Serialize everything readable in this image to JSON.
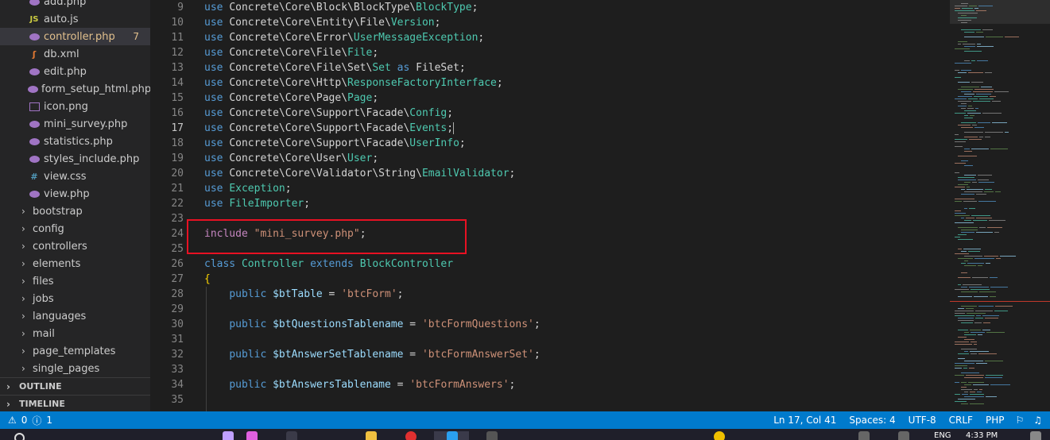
{
  "explorer": {
    "files": [
      {
        "name": "add.php",
        "icon": "php-file-icon"
      },
      {
        "name": "auto.js",
        "icon": "js-file-icon",
        "glyph": "JS"
      },
      {
        "name": "controller.php",
        "icon": "php-file-icon",
        "badge": "7",
        "active": true
      },
      {
        "name": "db.xml",
        "icon": "rss-file-icon",
        "glyph": "ʃ"
      },
      {
        "name": "edit.php",
        "icon": "php-file-icon"
      },
      {
        "name": "form_setup_html.php",
        "icon": "php-file-icon"
      },
      {
        "name": "icon.png",
        "icon": "image-file-icon"
      },
      {
        "name": "mini_survey.php",
        "icon": "php-file-icon"
      },
      {
        "name": "statistics.php",
        "icon": "php-file-icon"
      },
      {
        "name": "styles_include.php",
        "icon": "php-file-icon"
      },
      {
        "name": "view.css",
        "icon": "css-file-icon",
        "glyph": "#"
      },
      {
        "name": "view.php",
        "icon": "php-file-icon"
      }
    ],
    "folders": [
      "bootstrap",
      "config",
      "controllers",
      "elements",
      "files",
      "jobs",
      "languages",
      "mail",
      "page_templates",
      "single_pages"
    ],
    "outline_label": "OUTLINE",
    "timeline_label": "TIMELINE"
  },
  "editor": {
    "current_line": 17,
    "lines": [
      {
        "n": "9",
        "t": [
          [
            "kw",
            "use "
          ],
          [
            "",
            "Concrete\\Core\\Block\\BlockType\\"
          ],
          [
            "ty",
            "BlockType"
          ],
          [
            "",
            ";"
          ]
        ]
      },
      {
        "n": "10",
        "t": [
          [
            "kw",
            "use "
          ],
          [
            "",
            "Concrete\\Core\\Entity\\File\\"
          ],
          [
            "ty",
            "Version"
          ],
          [
            "",
            ";"
          ]
        ]
      },
      {
        "n": "11",
        "t": [
          [
            "kw",
            "use "
          ],
          [
            "",
            "Concrete\\Core\\Error\\"
          ],
          [
            "ty",
            "UserMessageException"
          ],
          [
            "",
            ";"
          ]
        ]
      },
      {
        "n": "12",
        "t": [
          [
            "kw",
            "use "
          ],
          [
            "",
            "Concrete\\Core\\File\\"
          ],
          [
            "ty",
            "File"
          ],
          [
            "",
            ";"
          ]
        ]
      },
      {
        "n": "13",
        "t": [
          [
            "kw",
            "use "
          ],
          [
            "",
            "Concrete\\Core\\File\\Set\\"
          ],
          [
            "ty",
            "Set"
          ],
          [
            "kw",
            " as "
          ],
          [
            "",
            "FileSet;"
          ]
        ]
      },
      {
        "n": "14",
        "t": [
          [
            "kw",
            "use "
          ],
          [
            "",
            "Concrete\\Core\\Http\\"
          ],
          [
            "ty",
            "ResponseFactoryInterface"
          ],
          [
            "",
            ";"
          ]
        ]
      },
      {
        "n": "15",
        "t": [
          [
            "kw",
            "use "
          ],
          [
            "",
            "Concrete\\Core\\Page\\"
          ],
          [
            "ty",
            "Page"
          ],
          [
            "",
            ";"
          ]
        ]
      },
      {
        "n": "16",
        "t": [
          [
            "kw",
            "use "
          ],
          [
            "",
            "Concrete\\Core\\Support\\Facade\\"
          ],
          [
            "ty",
            "Config"
          ],
          [
            "",
            ";"
          ]
        ]
      },
      {
        "n": "17",
        "t": [
          [
            "kw",
            "use "
          ],
          [
            "",
            "Concrete\\Core\\Support\\Facade\\"
          ],
          [
            "ty",
            "Events"
          ],
          [
            "",
            ";"
          ]
        ],
        "cursor": true
      },
      {
        "n": "18",
        "t": [
          [
            "kw",
            "use "
          ],
          [
            "",
            "Concrete\\Core\\Support\\Facade\\"
          ],
          [
            "ty",
            "UserInfo"
          ],
          [
            "",
            ";"
          ]
        ]
      },
      {
        "n": "19",
        "t": [
          [
            "kw",
            "use "
          ],
          [
            "",
            "Concrete\\Core\\User\\"
          ],
          [
            "ty",
            "User"
          ],
          [
            "",
            ";"
          ]
        ]
      },
      {
        "n": "20",
        "t": [
          [
            "kw",
            "use "
          ],
          [
            "",
            "Concrete\\Core\\Validator\\String\\"
          ],
          [
            "ty",
            "EmailValidator"
          ],
          [
            "",
            ";"
          ]
        ]
      },
      {
        "n": "21",
        "t": [
          [
            "kw",
            "use "
          ],
          [
            "ty",
            "Exception"
          ],
          [
            "",
            ";"
          ]
        ]
      },
      {
        "n": "22",
        "t": [
          [
            "kw",
            "use "
          ],
          [
            "ty",
            "FileImporter"
          ],
          [
            "",
            ";"
          ]
        ]
      },
      {
        "n": "23",
        "t": []
      },
      {
        "n": "24",
        "t": [
          [
            "inc",
            "include "
          ],
          [
            "st",
            "\"mini_survey.php\""
          ],
          [
            "",
            ";"
          ]
        ]
      },
      {
        "n": "25",
        "t": []
      },
      {
        "n": "26",
        "t": [
          [
            "kw",
            "class "
          ],
          [
            "ty",
            "Controller "
          ],
          [
            "kw",
            "extends "
          ],
          [
            "ty",
            "BlockController"
          ]
        ]
      },
      {
        "n": "27",
        "t": [
          [
            "br",
            "{"
          ]
        ]
      },
      {
        "n": "28",
        "t": [
          [
            "",
            "    "
          ],
          [
            "kw",
            "public "
          ],
          [
            "va",
            "$btTable"
          ],
          [
            "",
            " = "
          ],
          [
            "st",
            "'btcForm'"
          ],
          [
            "",
            ";"
          ]
        ]
      },
      {
        "n": "29",
        "t": []
      },
      {
        "n": "30",
        "t": [
          [
            "",
            "    "
          ],
          [
            "kw",
            "public "
          ],
          [
            "va",
            "$btQuestionsTablename"
          ],
          [
            "",
            " = "
          ],
          [
            "st",
            "'btcFormQuestions'"
          ],
          [
            "",
            ";"
          ]
        ]
      },
      {
        "n": "31",
        "t": []
      },
      {
        "n": "32",
        "t": [
          [
            "",
            "    "
          ],
          [
            "kw",
            "public "
          ],
          [
            "va",
            "$btAnswerSetTablename"
          ],
          [
            "",
            " = "
          ],
          [
            "st",
            "'btcFormAnswerSet'"
          ],
          [
            "",
            ";"
          ]
        ]
      },
      {
        "n": "33",
        "t": []
      },
      {
        "n": "34",
        "t": [
          [
            "",
            "    "
          ],
          [
            "kw",
            "public "
          ],
          [
            "va",
            "$btAnswersTablename"
          ],
          [
            "",
            " = "
          ],
          [
            "st",
            "'btcFormAnswers'"
          ],
          [
            "",
            ";"
          ]
        ]
      },
      {
        "n": "35",
        "t": []
      }
    ]
  },
  "status": {
    "errors": "0",
    "warnings": "1",
    "position": "Ln 17, Col 41",
    "spaces": "Spaces: 4",
    "encoding": "UTF-8",
    "eol": "CRLF",
    "language": "PHP"
  },
  "taskbar": {
    "lang": "ENG",
    "time": "4:33 PM"
  },
  "colors": {
    "accent": "#007acc",
    "highlight": "#e81123",
    "keyword": "#569cd6",
    "type": "#4ec9b0",
    "string": "#ce9178"
  }
}
